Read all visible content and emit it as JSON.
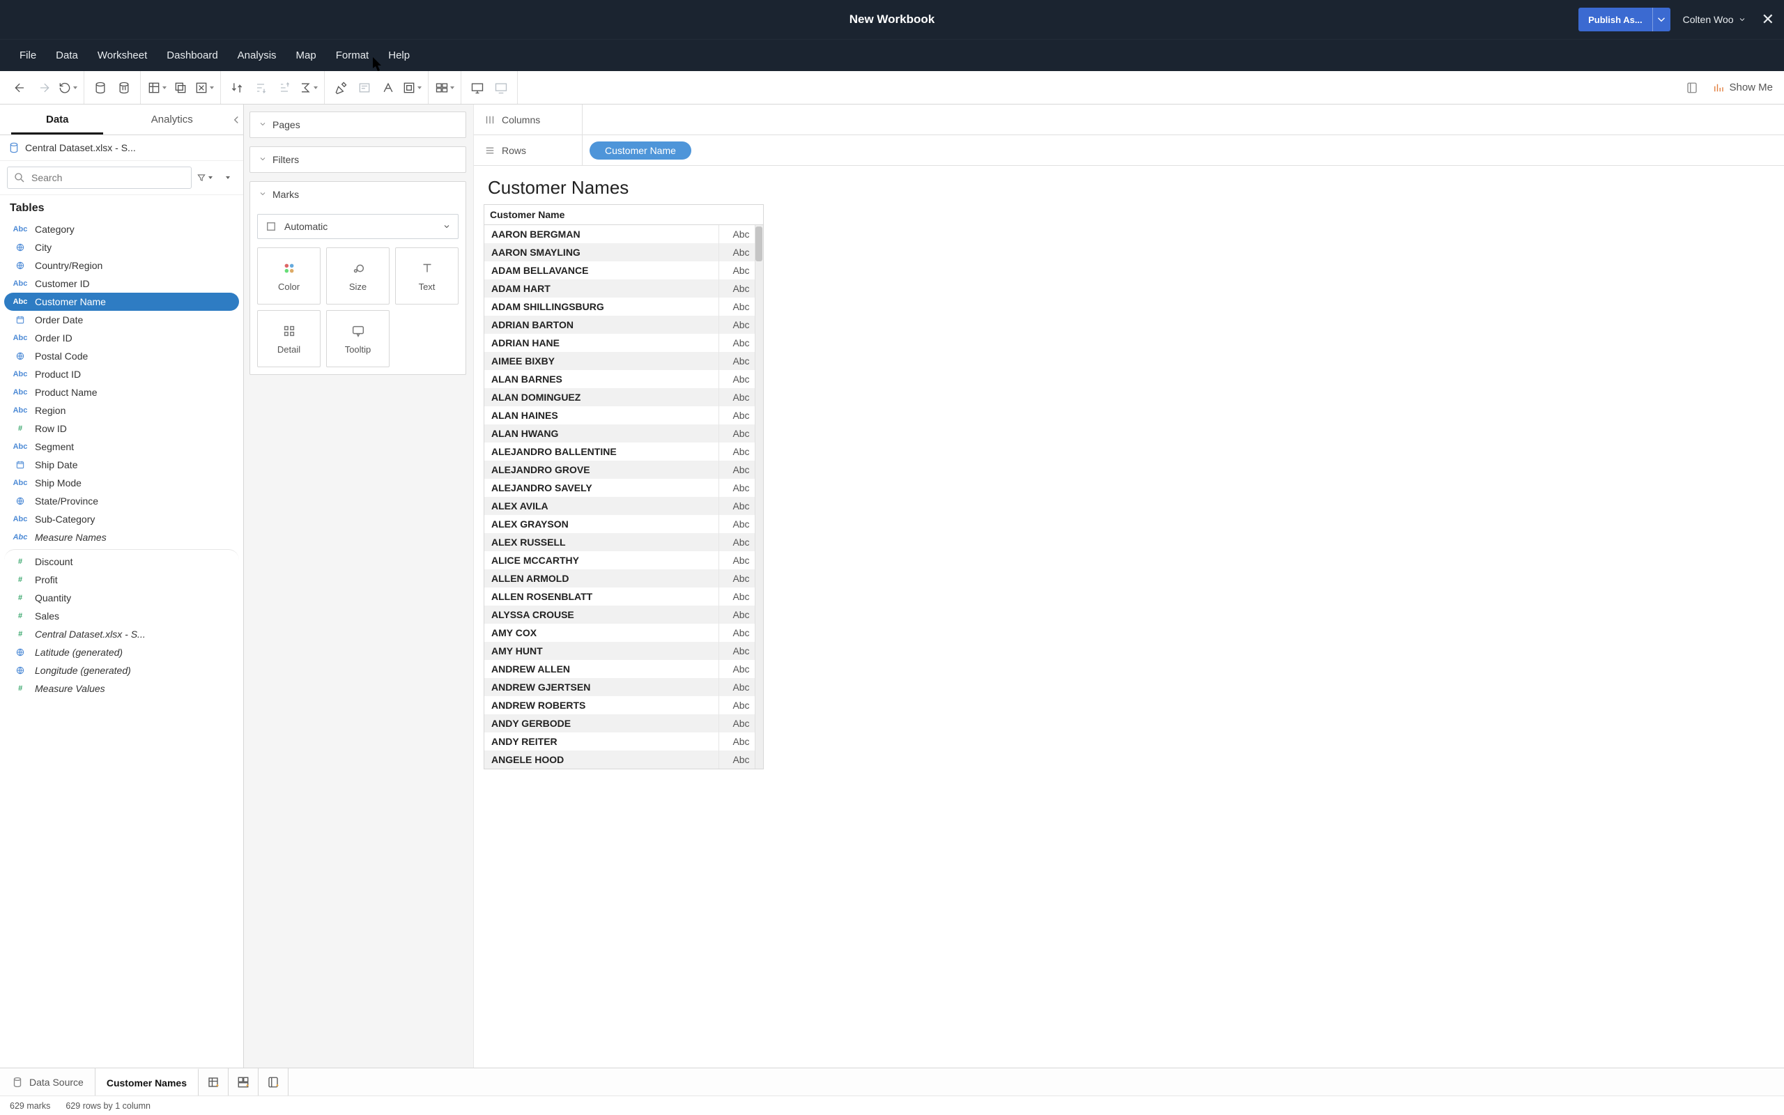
{
  "titlebar": {
    "workbook_title": "New Workbook",
    "publish_label": "Publish As...",
    "user_name": "Colten Woo"
  },
  "menubar": [
    "File",
    "Data",
    "Worksheet",
    "Dashboard",
    "Analysis",
    "Map",
    "Format",
    "Help"
  ],
  "toolbar_showme": "Show Me",
  "leftpane": {
    "tab_data": "Data",
    "tab_analytics": "Analytics",
    "datasource_label": "Central Dataset.xlsx - S...",
    "search_placeholder": "Search",
    "tables_header": "Tables",
    "fields": [
      {
        "icon": "abc",
        "label": "Category"
      },
      {
        "icon": "geo",
        "label": "City"
      },
      {
        "icon": "geo",
        "label": "Country/Region"
      },
      {
        "icon": "abc",
        "label": "Customer ID"
      },
      {
        "icon": "abc",
        "label": "Customer Name",
        "selected": true
      },
      {
        "icon": "date",
        "label": "Order Date"
      },
      {
        "icon": "abc",
        "label": "Order ID"
      },
      {
        "icon": "geo",
        "label": "Postal Code"
      },
      {
        "icon": "abc",
        "label": "Product ID"
      },
      {
        "icon": "abc",
        "label": "Product Name"
      },
      {
        "icon": "abc",
        "label": "Region"
      },
      {
        "icon": "num",
        "label": "Row ID"
      },
      {
        "icon": "abc",
        "label": "Segment"
      },
      {
        "icon": "date",
        "label": "Ship Date"
      },
      {
        "icon": "abc",
        "label": "Ship Mode"
      },
      {
        "icon": "geo",
        "label": "State/Province"
      },
      {
        "icon": "abc",
        "label": "Sub-Category"
      },
      {
        "icon": "abc",
        "label": "Measure Names",
        "italic": true
      },
      {
        "icon": "num",
        "label": "Discount",
        "divider": true
      },
      {
        "icon": "num",
        "label": "Profit"
      },
      {
        "icon": "num",
        "label": "Quantity"
      },
      {
        "icon": "num",
        "label": "Sales"
      },
      {
        "icon": "num",
        "label": "Central Dataset.xlsx - S...",
        "italic": true
      },
      {
        "icon": "geo",
        "label": "Latitude (generated)",
        "italic": true
      },
      {
        "icon": "geo",
        "label": "Longitude (generated)",
        "italic": true
      },
      {
        "icon": "num",
        "label": "Measure Values",
        "italic": true
      }
    ]
  },
  "cards": {
    "pages": "Pages",
    "filters": "Filters",
    "marks": "Marks",
    "marks_type": "Automatic",
    "mark_cells": [
      "Color",
      "Size",
      "Text",
      "Detail",
      "Tooltip"
    ]
  },
  "shelves": {
    "columns_label": "Columns",
    "rows_label": "Rows",
    "rows_pill": "Customer Name"
  },
  "view": {
    "title": "Customer Names",
    "column_header": "Customer Name",
    "value_marker": "Abc",
    "rows": [
      "AARON BERGMAN",
      "AARON SMAYLING",
      "ADAM BELLAVANCE",
      "ADAM HART",
      "ADAM SHILLINGSBURG",
      "ADRIAN BARTON",
      "ADRIAN HANE",
      "AIMEE BIXBY",
      "ALAN BARNES",
      "ALAN DOMINGUEZ",
      "ALAN HAINES",
      "ALAN HWANG",
      "ALEJANDRO BALLENTINE",
      "ALEJANDRO GROVE",
      "ALEJANDRO SAVELY",
      "ALEX AVILA",
      "ALEX GRAYSON",
      "ALEX RUSSELL",
      "ALICE MCCARTHY",
      "ALLEN ARMOLD",
      "ALLEN ROSENBLATT",
      "ALYSSA CROUSE",
      "AMY COX",
      "AMY HUNT",
      "ANDREW ALLEN",
      "ANDREW GJERTSEN",
      "ANDREW ROBERTS",
      "ANDY GERBODE",
      "ANDY REITER",
      "ANGELE HOOD"
    ]
  },
  "bottomtabs": {
    "datasource": "Data Source",
    "sheet_active": "Customer Names"
  },
  "statusbar": {
    "marks": "629 marks",
    "dims": "629 rows by 1 column"
  }
}
